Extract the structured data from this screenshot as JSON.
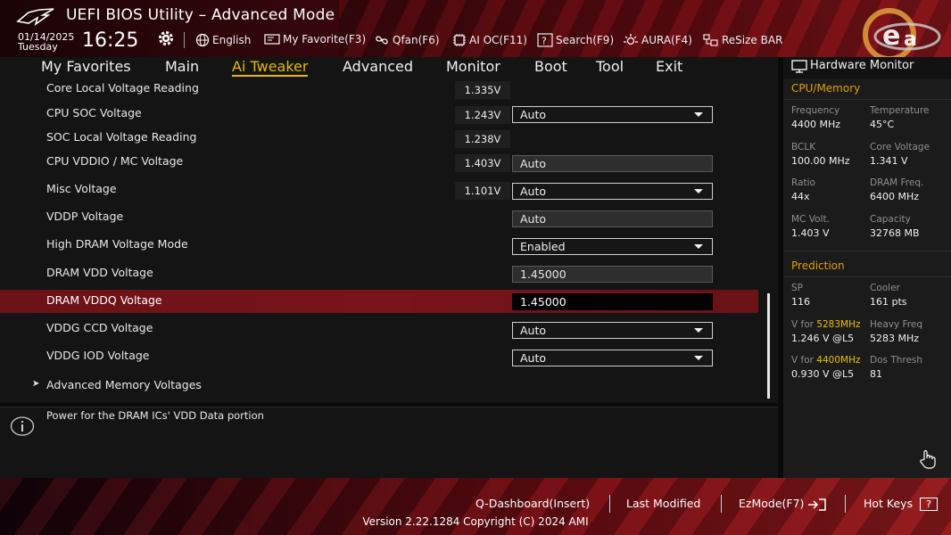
{
  "header": {
    "title": "UEFI BIOS Utility – Advanced Mode",
    "date": "01/14/2025",
    "weekday": "Tuesday",
    "time": "16:25",
    "toolbar": [
      {
        "label": "English",
        "icon": "globe-icon"
      },
      {
        "label": "My Favorite(F3)",
        "icon": "favorite-icon"
      },
      {
        "label": "Qfan(F6)",
        "icon": "fan-icon"
      },
      {
        "label": "AI OC(F11)",
        "icon": "ai-chip-icon"
      },
      {
        "label": "Search(F9)",
        "icon": "search-icon"
      },
      {
        "label": "AURA(F4)",
        "icon": "aura-icon"
      },
      {
        "label": "ReSize BAR",
        "icon": "resize-bar-icon"
      }
    ]
  },
  "nav": {
    "tabs": [
      "My Favorites",
      "Main",
      "Ai Tweaker",
      "Advanced",
      "Monitor",
      "Boot",
      "Tool",
      "Exit"
    ],
    "active": "Ai Tweaker"
  },
  "settings": {
    "rows": [
      {
        "label": "Core Local Voltage Reading",
        "reading": "1.335V"
      },
      {
        "label": "CPU SOC Voltage",
        "reading": "1.243V",
        "value": "Auto",
        "control": "dropdown"
      },
      {
        "label": "SOC Local Voltage Reading",
        "reading": "1.238V"
      },
      {
        "label": "CPU VDDIO / MC Voltage",
        "reading": "1.403V",
        "value": "Auto",
        "control": "field"
      },
      {
        "label": "Misc Voltage",
        "reading": "1.101V",
        "value": "Auto",
        "control": "dropdown"
      },
      {
        "label": "VDDP Voltage",
        "value": "Auto",
        "control": "field"
      },
      {
        "label": "High DRAM Voltage Mode",
        "value": "Enabled",
        "control": "dropdown"
      },
      {
        "label": "DRAM VDD Voltage",
        "value": "1.45000",
        "control": "field"
      },
      {
        "label": "DRAM VDDQ Voltage",
        "value": "1.45000",
        "control": "field-active",
        "selected": true
      },
      {
        "label": "VDDG CCD Voltage",
        "value": "Auto",
        "control": "dropdown"
      },
      {
        "label": "VDDG IOD Voltage",
        "value": "Auto",
        "control": "dropdown"
      },
      {
        "label": "Advanced Memory Voltages",
        "control": "submenu"
      }
    ]
  },
  "help": {
    "text": "Power for the DRAM ICs' VDD Data portion"
  },
  "hardware_monitor": {
    "title": "Hardware Monitor",
    "cpu_memory": {
      "title": "CPU/Memory",
      "items": [
        {
          "label": "Frequency",
          "value": "4400 MHz"
        },
        {
          "label": "Temperature",
          "value": "45°C"
        },
        {
          "label": "BCLK",
          "value": "100.00 MHz"
        },
        {
          "label": "Core Voltage",
          "value": "1.341 V"
        },
        {
          "label": "Ratio",
          "value": "44x"
        },
        {
          "label": "DRAM Freq.",
          "value": "6400 MHz"
        },
        {
          "label": "MC Volt.",
          "value": "1.403 V"
        },
        {
          "label": "Capacity",
          "value": "32768 MB"
        }
      ]
    },
    "prediction": {
      "title": "Prediction",
      "sp_label": "SP",
      "sp_value": "116",
      "cooler_label": "Cooler",
      "cooler_value": "161 pts",
      "v_for_prefix": "V for ",
      "v1_freq": "5283MHz",
      "v1_value": "1.246 V @L5",
      "heavy_label": "Heavy Freq",
      "heavy_value": "5283 MHz",
      "v2_freq": "4400MHz",
      "v2_value": "0.930 V @L5",
      "dos_label": "Dos Thresh",
      "dos_value": "81"
    }
  },
  "footer": {
    "qdashboard": "Q-Dashboard(Insert)",
    "last_modified": "Last Modified",
    "ezmode": "EzMode(F7)",
    "hotkeys": "Hot Keys",
    "hotkeys_key": "?",
    "version": "Version 2.22.1284 Copyright (C) 2024 AMI"
  },
  "colors": {
    "accent": "#e6b800",
    "highlight_row": "#7a1418",
    "section_title": "#e0a000"
  }
}
